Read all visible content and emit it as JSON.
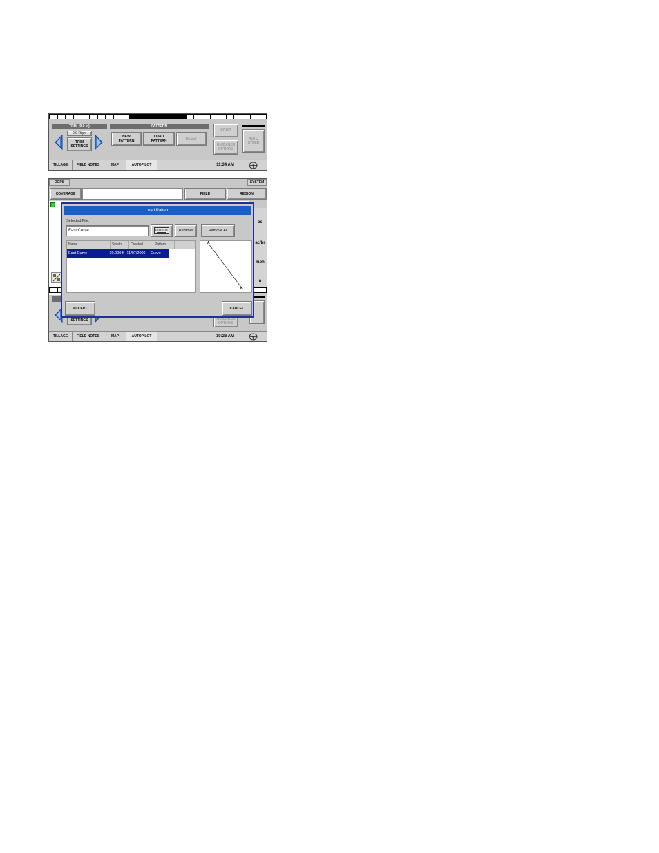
{
  "screen1": {
    "trim_header": "TRIM (0.0 in)",
    "trim_value": "0.0 Right",
    "trim_settings": "TRIM SETTINGS",
    "pattern_header": "PATTERN",
    "new_pattern": "NEW PATTERN",
    "load_pattern": "LOAD PATTERN",
    "reset": "RESET",
    "point": "POINT",
    "guidance_options": "GUIDANCE OPTIONS",
    "auto_steer": "AUTO STEER",
    "tabs": [
      "TILLAGE",
      "FIELD NOTES",
      "MAP",
      "AUTOPILOT"
    ],
    "time": "11:34 AM"
  },
  "screen2": {
    "top_left": "DGPS",
    "top_right": "SYSTEM",
    "coverage": "COVERAGE",
    "field": "FIELD",
    "region": "REGION",
    "side_units": [
      "ac",
      "ac/hr",
      "mph",
      "ft"
    ],
    "settings": "SETTINGS",
    "guidance_options": "GUIDANCE OPTIONS",
    "tabs": [
      "TILLAGE",
      "FIELD NOTES",
      "MAP",
      "AUTOPILOT"
    ],
    "time": "10:26 AM",
    "dialog": {
      "title": "Load Pattern",
      "selected_file_label": "Selected File:",
      "selected_file_value": "East Curve",
      "remove": "Remove",
      "remove_all": "Remove All",
      "columns": [
        "Name",
        "Swath",
        "Created",
        "Pattern"
      ],
      "rows": [
        {
          "name": "East Curve",
          "swath": "30.000 ft",
          "created": "11/07/2006",
          "pattern": "Curve"
        }
      ],
      "point_a": "A",
      "point_b": "B",
      "accept": "ACCEPT",
      "cancel": "CANCEL"
    }
  },
  "colors": {
    "dialog_title_bg": "#1a5fc8",
    "dialog_border": "#1f2f9c",
    "selection_bg": "#0c1e8f",
    "panel_gray": "#c8c8c8",
    "header_dark": "#6d6d6d",
    "green_indicator": "#2bd12b",
    "arrow_blue": "#3f7fd0"
  },
  "icons": [
    "left-arrow-icon",
    "right-arrow-icon",
    "steering-wheel-icon",
    "keyboard-icon",
    "map-zoom-icon"
  ]
}
